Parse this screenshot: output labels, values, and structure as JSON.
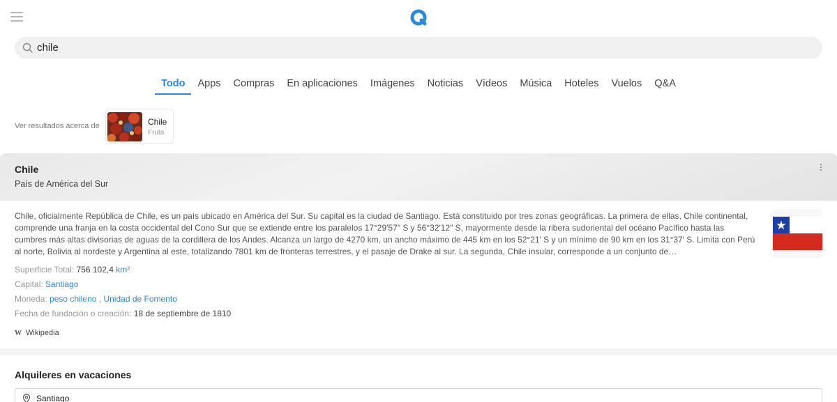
{
  "search": {
    "query": "chile"
  },
  "tabs": [
    {
      "label": "Todo",
      "active": true
    },
    {
      "label": "Apps"
    },
    {
      "label": "Compras"
    },
    {
      "label": "En aplicaciones"
    },
    {
      "label": "Imágenes"
    },
    {
      "label": "Noticias"
    },
    {
      "label": "Vídeos"
    },
    {
      "label": "Música"
    },
    {
      "label": "Hoteles"
    },
    {
      "label": "Vuelos"
    },
    {
      "label": "Q&A"
    }
  ],
  "disambiguation": {
    "prompt": "Ver resultados acerca de",
    "entity_name": "Chile",
    "entity_type": "Fruta"
  },
  "knowledge_panel": {
    "title": "Chile",
    "subtitle": "País de América del Sur",
    "description": "Chile, oficialmente República de Chile, es un país ubicado en América del Sur. Su capital es la ciudad de Santiago. Está constituido por tres zonas geográficas. La primera de ellas, Chile continental, comprende una franja en la costa occidental del Cono Sur que se extiende entre los paralelos 17°29′57″ S y 56°32′12″ S, mayormente desde la ribera sudoriental del océano Pacífico hasta las cumbres más altas divisorias de aguas de la cordillera de los Andes. Alcanza un largo de 4270 km, un ancho máximo de 445 km en los 52°21′ S y un mínimo de 90 km en los 31°37′ S. Limita con Perú al norte, Bolivia al nordeste y Argentina al este, totalizando 7801 km de fronteras terrestres, y el pasaje de Drake al sur. La segunda, Chile insular, corresponde a un conjunto de…",
    "facts": {
      "area_label": "Superficie Total:",
      "area_value": "756 102,4",
      "area_unit": "km²",
      "capital_label": "Capital:",
      "capital_value": "Santiago",
      "currency_label": "Moneda:",
      "currency_value_1": "peso chileno",
      "currency_sep": ",",
      "currency_value_2": "Unidad de Fomento",
      "founding_label": "Fecha de fundación o creación:",
      "founding_value": "18 de septiembre de 1810"
    },
    "source_icon": "W",
    "source": "Wikipedia"
  },
  "rentals": {
    "title": "Alquileres en vacaciones",
    "location": "Santiago"
  },
  "colors": {
    "accent": "#2a89d9",
    "flag_blue": "#1f3fa8",
    "flag_red": "#d52b1e"
  },
  "icons": {
    "menu": "menu-icon",
    "search": "search-icon",
    "more": "more-vertical-icon",
    "pin": "location-pin-icon"
  }
}
